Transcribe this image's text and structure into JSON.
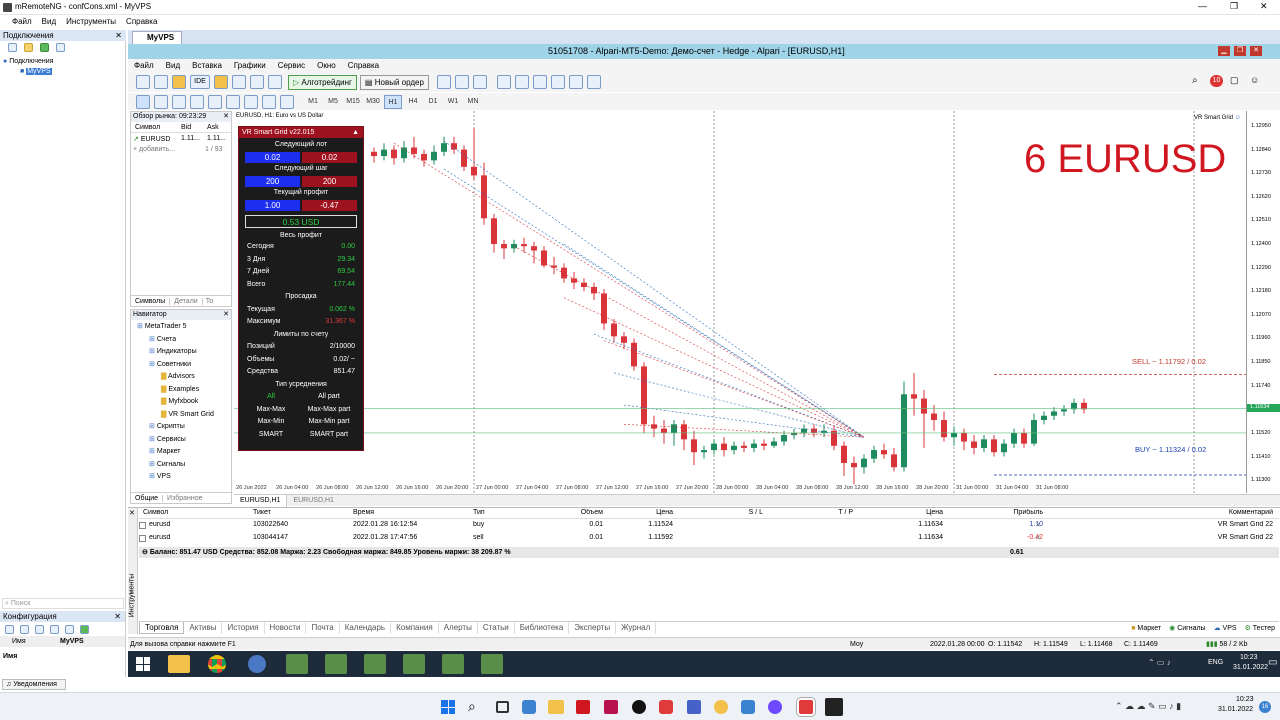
{
  "remote_window": {
    "title": "mRemoteNG - confCons.xml - MyVPS",
    "menu": [
      "Файл",
      "Вид",
      "Инструменты",
      "Справка"
    ],
    "ctrl": [
      "—",
      "❐",
      "✕"
    ]
  },
  "connections": {
    "title": "Подключения",
    "root": "Подключения",
    "item": "MyVPS",
    "search": "Поиск",
    "config": "Конфигурация",
    "name_col": "Имя",
    "name_val": "MyVPS",
    "name_row": "Имя",
    "notifications": "Уведомления"
  },
  "tab": {
    "label": "MyVPS"
  },
  "mt5": {
    "title": "51051708 - Alpari-MT5-Demo: Демо-счет - Hedge - Alpari - [EURUSD,H1]",
    "menu": [
      "Файл",
      "Вид",
      "Вставка",
      "Графики",
      "Сервис",
      "Окно",
      "Справка"
    ],
    "toolbar": {
      "algo": "Алготрейдинг",
      "order": "Новый ордер",
      "ide": "IDE"
    },
    "timeframes": [
      "M1",
      "M5",
      "M15",
      "M30",
      "H1",
      "H4",
      "D1",
      "W1",
      "MN"
    ],
    "active_tf": "H1"
  },
  "market_watch": {
    "title": "Обзор рынка: 09:23:29",
    "cols": [
      "Символ",
      "Bid",
      "Ask"
    ],
    "row": {
      "sym": "EURUSD",
      "bid": "1.11...",
      "ask": "1.11..."
    },
    "add": "добавить...",
    "count": "1 / 93",
    "tabs": [
      "Символы",
      "Детали",
      "То"
    ]
  },
  "navigator": {
    "title": "Навигатор",
    "items": [
      {
        "t": "MetaTrader 5",
        "lvl": 0
      },
      {
        "t": "Счета",
        "lvl": 1
      },
      {
        "t": "Индикаторы",
        "lvl": 1
      },
      {
        "t": "Советники",
        "lvl": 1
      },
      {
        "t": "Advisors",
        "lvl": 2
      },
      {
        "t": "Examples",
        "lvl": 2
      },
      {
        "t": "Myfxbook",
        "lvl": 2
      },
      {
        "t": "VR Smart Grid",
        "lvl": 2
      },
      {
        "t": "Скрипты",
        "lvl": 1
      },
      {
        "t": "Сервисы",
        "lvl": 1
      },
      {
        "t": "Маркет",
        "lvl": 1
      },
      {
        "t": "Сигналы",
        "lvl": 1
      },
      {
        "t": "VPS",
        "lvl": 1
      }
    ],
    "tabs": [
      "Общие",
      "Избранное"
    ]
  },
  "chart": {
    "header": "EURUSD, H1: Euro vs US Dollar",
    "watermark": "6 EURUSD",
    "ea_name": "VR Smart Grid",
    "sell_label": "SELL ~ 1.11792 / 0.02",
    "buy_label": "BUY ~ 1.11324 / 0.02",
    "current_price": "1.11634",
    "prices": [
      "1.12950",
      "1.12840",
      "1.12730",
      "1.12620",
      "1.12510",
      "1.12400",
      "1.12290",
      "1.12180",
      "1.12070",
      "1.11960",
      "1.11850",
      "1.11740",
      "1.11520",
      "1.11410",
      "1.11300"
    ],
    "dates": [
      "26 Jun 2022",
      "26 Jun 04:00",
      "26 Jun 08:00",
      "26 Jun 12:00",
      "26 Jun 16:00",
      "26 Jun 20:00",
      "27 Jun 00:00",
      "27 Jun 04:00",
      "27 Jun 08:00",
      "27 Jun 12:00",
      "27 Jun 16:00",
      "27 Jun 20:00",
      "28 Jun 00:00",
      "28 Jun 04:00",
      "28 Jun 08:00",
      "28 Jun 12:00",
      "28 Jun 16:00",
      "28 Jun 20:00",
      "31 Jun 00:00",
      "31 Jun 04:00",
      "31 Jun 08:00"
    ],
    "tabs": [
      "EURUSD,H1",
      "EURUSD,H1"
    ]
  },
  "vr_panel": {
    "title": "VR Smart Grid v22.015",
    "next_lot": "Следующий лот",
    "lot_buy": "0.02",
    "lot_sell": "0.02",
    "next_step": "Следующий шаг",
    "step_buy": "200",
    "step_sell": "200",
    "cur_profit": "Текущий профит",
    "profit_buy": "1.00",
    "profit_sell": "-0.47",
    "total": "0.53 USD",
    "all_profit": "Весь профит",
    "rows": [
      {
        "l": "Сегодня",
        "v": "0.00"
      },
      {
        "l": "3 Дня",
        "v": "29.34"
      },
      {
        "l": "7 Дней",
        "v": "69.54"
      },
      {
        "l": "Всего",
        "v": "177.44"
      }
    ],
    "drawdown": "Просадка",
    "dd_rows": [
      {
        "l": "Текущая",
        "v": "0.062 %"
      },
      {
        "l": "Максимум",
        "v": "31.367 %"
      }
    ],
    "limits": "Лимиты по счету",
    "lim_rows": [
      {
        "l": "Позиций",
        "v": "2/10000"
      },
      {
        "l": "Объемы",
        "v": "0.02/ ~"
      },
      {
        "l": "Средства",
        "v": "851.47"
      }
    ],
    "avg_type": "Тип усреднения",
    "btns": [
      [
        "All",
        "All part"
      ],
      [
        "Max-Max",
        "Max-Max part"
      ],
      [
        "Max-Min",
        "Max-Min part"
      ],
      [
        "SMART",
        "SMART part"
      ]
    ]
  },
  "trade": {
    "cols": [
      "Символ",
      "Тикет",
      "Время",
      "Тип",
      "Объем",
      "Цена",
      "S / L",
      "T / P",
      "Цена",
      "Прибыль",
      "Комментарий"
    ],
    "rows": [
      [
        "eurusd",
        "103022640",
        "2022.01.28 16:12:54",
        "buy",
        "0.01",
        "1.11524",
        "",
        "",
        "1.11634",
        "1.10",
        "VR Smart Grid 22"
      ],
      [
        "eurusd",
        "103044147",
        "2022.01.28 17:47:56",
        "sell",
        "0.01",
        "1.11592",
        "",
        "",
        "1.11634",
        "-0.42",
        "VR Smart Grid 22"
      ]
    ],
    "balance": "Баланс: 851.47 USD  Средства: 852.08  Маржа: 2.23  Свободная маржа: 849.85  Уровень маржи: 38 209.87 %",
    "balance_profit": "0.61",
    "tabs": [
      "Торговля",
      "Активы",
      "История",
      "Новости",
      "Почта",
      "Календарь",
      "Компания",
      "Алерты",
      "Статьи",
      "Библиотека",
      "Эксперты",
      "Журнал"
    ],
    "right_tabs": [
      "Маркет",
      "Сигналы",
      "VPS",
      "Тестер"
    ],
    "side": "Инструменты"
  },
  "status": {
    "help": "Для вызова справки нажмите F1",
    "profile": "Moy",
    "time": "2022.01.28 00:00",
    "o": "O: 1.11542",
    "h": "H: 1.11549",
    "l": "L: 1.11468",
    "c": "C: 1.11469",
    "kb": "58 / 2 Kb"
  },
  "vps_taskbar": {
    "lang": "ENG",
    "time": "10:23",
    "date": "31.01.2022"
  },
  "host_taskbar": {
    "time": "10:23",
    "date": "31.01.2022",
    "badge": "16"
  }
}
